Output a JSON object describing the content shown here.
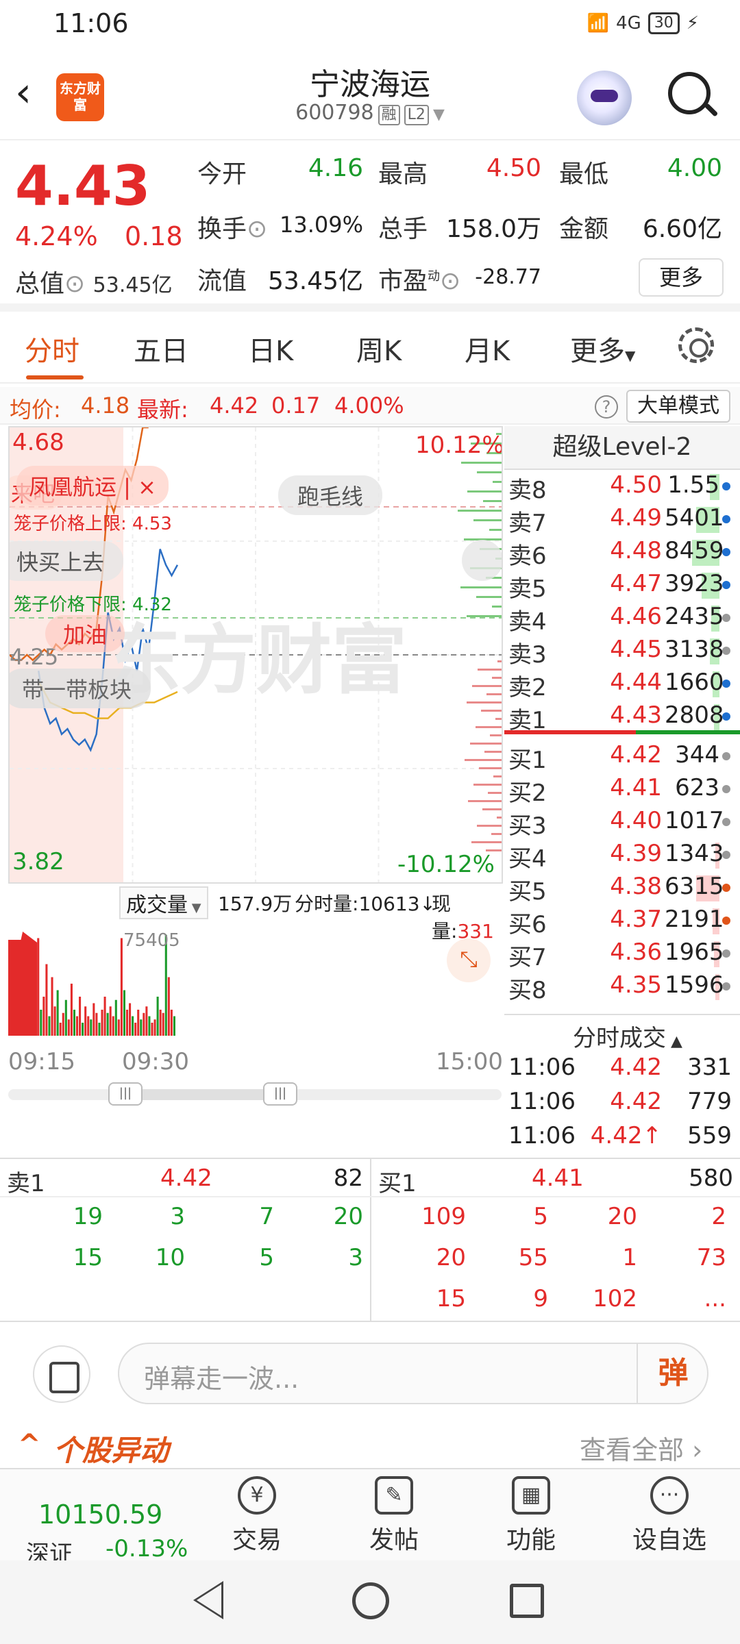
{
  "status": {
    "time": "11:06",
    "network": "4G",
    "battery": "30"
  },
  "header": {
    "logo_text": "东方财富",
    "stock_name": "宁波海运",
    "stock_code": "600798",
    "tag_margin": "融",
    "tag_level": "L2"
  },
  "quote": {
    "price": "4.43",
    "pct": "4.24%",
    "change": "0.18",
    "market_cap_label": "总值",
    "market_cap": "53.45亿",
    "open_label": "今开",
    "open": "4.16",
    "high_label": "最高",
    "high": "4.50",
    "low_label": "最低",
    "low": "4.00",
    "turnover_label": "换手",
    "turnover": "13.09%",
    "vol_label": "总手",
    "volume": "158.0万",
    "amount_label": "金额",
    "amount": "6.60亿",
    "float_label": "流值",
    "float_cap": "53.45亿",
    "pe_label": "市盈",
    "pe_dyn": "动",
    "pe": "-28.77",
    "more": "更多"
  },
  "tabs": [
    "分时",
    "五日",
    "日K",
    "周K",
    "月K",
    "更多"
  ],
  "infobar": {
    "avg_label": "均价:",
    "avg": "4.18",
    "latest_label": "最新:",
    "latest": "4.42",
    "latest_chg": "0.17",
    "latest_pct": "4.00%",
    "help": "?",
    "big_order": "大单模式"
  },
  "chart": {
    "y_max": "4.68",
    "y_min": "3.82",
    "pct_max": "10.12%",
    "pct_min": "-10.12%",
    "mid": "4.25",
    "cage_upper": "笼子价格上限:  4.53",
    "cage_lower": "笼子价格下限:  4.32",
    "danmu": [
      "来吧",
      "凤凰航运 | ×",
      "跑毛线",
      "快买上去",
      "加油",
      "带一带板块"
    ],
    "watermark": "东方财富"
  },
  "chart_data": {
    "type": "line",
    "x_range": [
      "09:15",
      "15:00"
    ],
    "ylim": [
      3.82,
      4.68
    ],
    "series": [
      {
        "name": "latest",
        "x": [
          "09:30",
          "09:33",
          "09:36",
          "09:39",
          "09:42",
          "09:45",
          "09:48",
          "09:51",
          "09:54",
          "09:57",
          "10:00",
          "10:03",
          "10:06",
          "10:09",
          "10:12",
          "10:15",
          "10:18",
          "10:21",
          "10:24",
          "10:27",
          "10:30",
          "10:33",
          "10:36",
          "10:39",
          "10:42"
        ],
        "values": [
          4.22,
          4.15,
          4.12,
          4.13,
          4.1,
          4.11,
          4.09,
          4.08,
          4.09,
          4.07,
          4.1,
          4.2,
          4.33,
          4.28,
          4.3,
          4.24,
          4.27,
          4.22,
          4.3,
          4.26,
          4.35,
          4.45,
          4.42,
          4.4,
          4.42
        ]
      },
      {
        "name": "avg",
        "x": [
          "09:30",
          "09:36",
          "09:42",
          "09:48",
          "09:54",
          "10:00",
          "10:06",
          "10:12",
          "10:18",
          "10:24",
          "10:30",
          "10:36",
          "10:42"
        ],
        "values": [
          4.2,
          4.16,
          4.15,
          4.14,
          4.14,
          4.13,
          4.13,
          4.15,
          4.15,
          4.16,
          4.16,
          4.17,
          4.18
        ]
      },
      {
        "name": "bid_ask_ratio",
        "x": [
          "09:15",
          "09:18",
          "09:21",
          "09:24",
          "09:27",
          "09:30",
          "09:33",
          "09:36",
          "09:39",
          "09:42",
          "09:45",
          "09:48",
          "09:51",
          "09:54",
          "09:57",
          "10:00",
          "10:03",
          "10:06",
          "10:09",
          "10:12",
          "10:15",
          "10:18",
          "10:21",
          "10:24",
          "10:27"
        ],
        "values": [
          4.25,
          4.24,
          4.24,
          4.25,
          4.24,
          4.25,
          4.26,
          4.25,
          4.27,
          4.26,
          4.27,
          4.28,
          4.27,
          4.29,
          4.28,
          4.3,
          4.4,
          4.55,
          4.52,
          4.56,
          4.6,
          4.58,
          4.62,
          4.68,
          4.68
        ]
      }
    ]
  },
  "volume": {
    "label": "成交量",
    "total": "157.9万",
    "tick_vol_label": "分时量:",
    "tick_vol": "10613↓",
    "now_label": "现量:",
    "now": "331",
    "max": "75405",
    "times": [
      "09:15",
      "09:30",
      "15:00"
    ]
  },
  "level2": {
    "title": "超级Level-2",
    "asks": [
      {
        "l": "卖8",
        "p": "4.50",
        "v": "1.55万"
      },
      {
        "l": "卖7",
        "p": "4.49",
        "v": "5401"
      },
      {
        "l": "卖6",
        "p": "4.48",
        "v": "8459"
      },
      {
        "l": "卖5",
        "p": "4.47",
        "v": "3923"
      },
      {
        "l": "卖4",
        "p": "4.46",
        "v": "2435"
      },
      {
        "l": "卖3",
        "p": "4.45",
        "v": "3138"
      },
      {
        "l": "卖2",
        "p": "4.44",
        "v": "1660"
      },
      {
        "l": "卖1",
        "p": "4.43",
        "v": "2808"
      }
    ],
    "bids": [
      {
        "l": "买1",
        "p": "4.42",
        "v": "344"
      },
      {
        "l": "买2",
        "p": "4.41",
        "v": "623"
      },
      {
        "l": "买3",
        "p": "4.40",
        "v": "1017"
      },
      {
        "l": "买4",
        "p": "4.39",
        "v": "1343"
      },
      {
        "l": "买5",
        "p": "4.38",
        "v": "6315"
      },
      {
        "l": "买6",
        "p": "4.37",
        "v": "2191"
      },
      {
        "l": "买7",
        "p": "4.36",
        "v": "1965"
      },
      {
        "l": "买8",
        "p": "4.35",
        "v": "1596"
      }
    ],
    "trades_title": "分时成交",
    "trades": [
      {
        "t": "11:06",
        "p": "4.42",
        "v": "331"
      },
      {
        "t": "11:06",
        "p": "4.42",
        "v": "779"
      },
      {
        "t": "11:06",
        "p": "4.42↑",
        "v": "559"
      }
    ]
  },
  "queue": {
    "sell_label": "卖1",
    "sell_price": "4.42",
    "sell_total": "82",
    "sell_rows": [
      [
        "19",
        "3",
        "7",
        "20"
      ],
      [
        "15",
        "10",
        "5",
        "3"
      ]
    ],
    "buy_label": "买1",
    "buy_price": "4.41",
    "buy_total": "580",
    "buy_rows": [
      [
        "109",
        "5",
        "20",
        "2"
      ],
      [
        "20",
        "55",
        "1",
        "73"
      ],
      [
        "15",
        "9",
        "102",
        "..."
      ]
    ]
  },
  "comment": {
    "placeholder": "弹幕走一波...",
    "send": "弹"
  },
  "movers": {
    "title": "个股异动",
    "view_all": "查看全部"
  },
  "bottom_nav": {
    "index_value": "10150.59",
    "index_name": "深证",
    "index_chg": "-0.13%",
    "items": [
      "交易",
      "发帖",
      "功能",
      "设自选"
    ]
  },
  "colors": {
    "up": "#e32a2a",
    "down": "#1a9a2a",
    "accent": "#e0551a",
    "line_price": "#2c6fc4",
    "line_avg": "#e8b020",
    "line_ratio": "#e0651a"
  }
}
